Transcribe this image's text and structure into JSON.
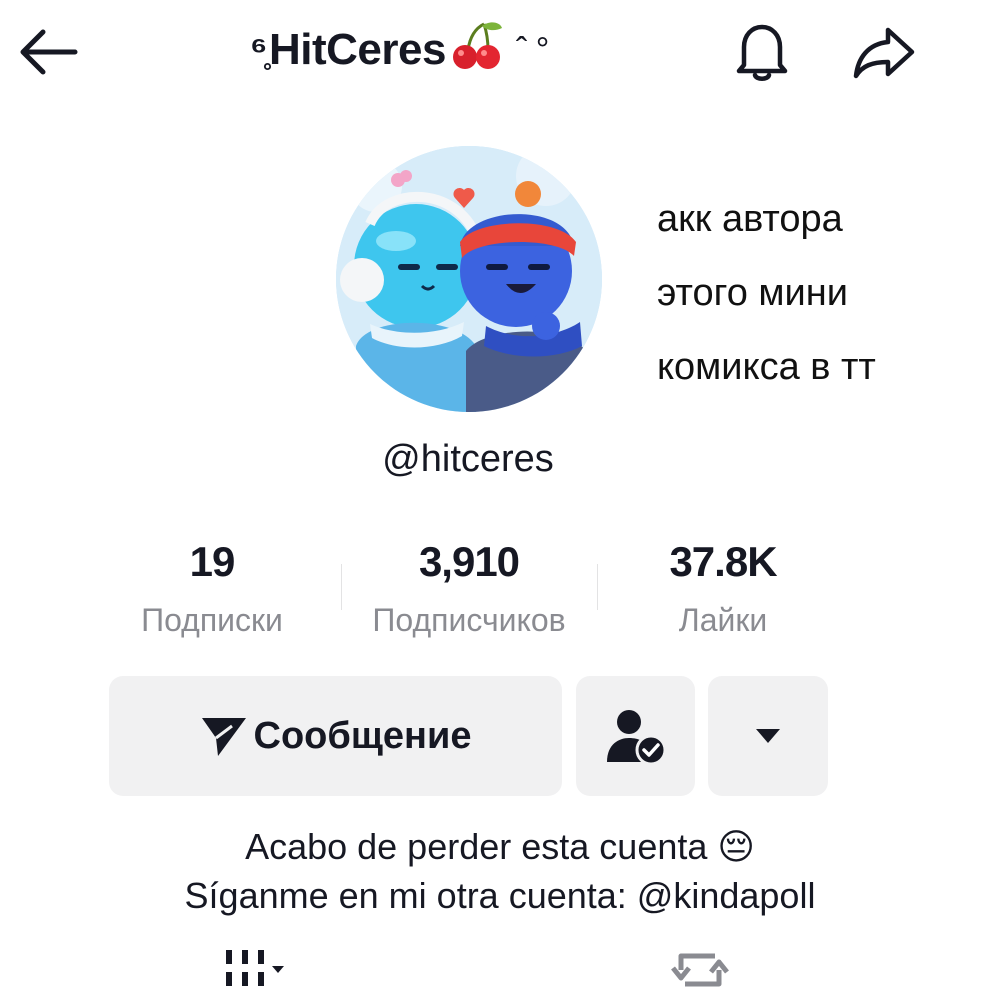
{
  "header": {
    "title": "HitCeres",
    "title_prefix_deco": "⁶̥",
    "title_suffix_deco": "ˆ °",
    "icons": [
      "back-arrow-icon",
      "cherry-icon",
      "bell-icon",
      "share-icon"
    ]
  },
  "overlay_caption": {
    "line1": "акк автора",
    "line2": "этого мини",
    "line3": "комикса в тт"
  },
  "profile": {
    "username": "@hitceres"
  },
  "stats": {
    "following_count": "19",
    "following_label": "Подписки",
    "followers_count": "3,910",
    "followers_label": "Подписчиков",
    "likes_count": "37.8K",
    "likes_label": "Лайки"
  },
  "actions": {
    "message_label": "Сообщение",
    "icons": [
      "send-icon",
      "person-check-icon",
      "caret-down-icon"
    ]
  },
  "bio": {
    "line1": "Acabo de perder esta cuenta",
    "line1_emoji": "😔",
    "line2": "Síganme en mi otra cuenta: @kindapoll"
  },
  "tabs": {
    "icons": [
      "grid-icon",
      "repost-icon"
    ]
  },
  "colors": {
    "text": "#161823",
    "secondary_text": "#8a8b91",
    "button_bg": "#f1f1f2"
  }
}
